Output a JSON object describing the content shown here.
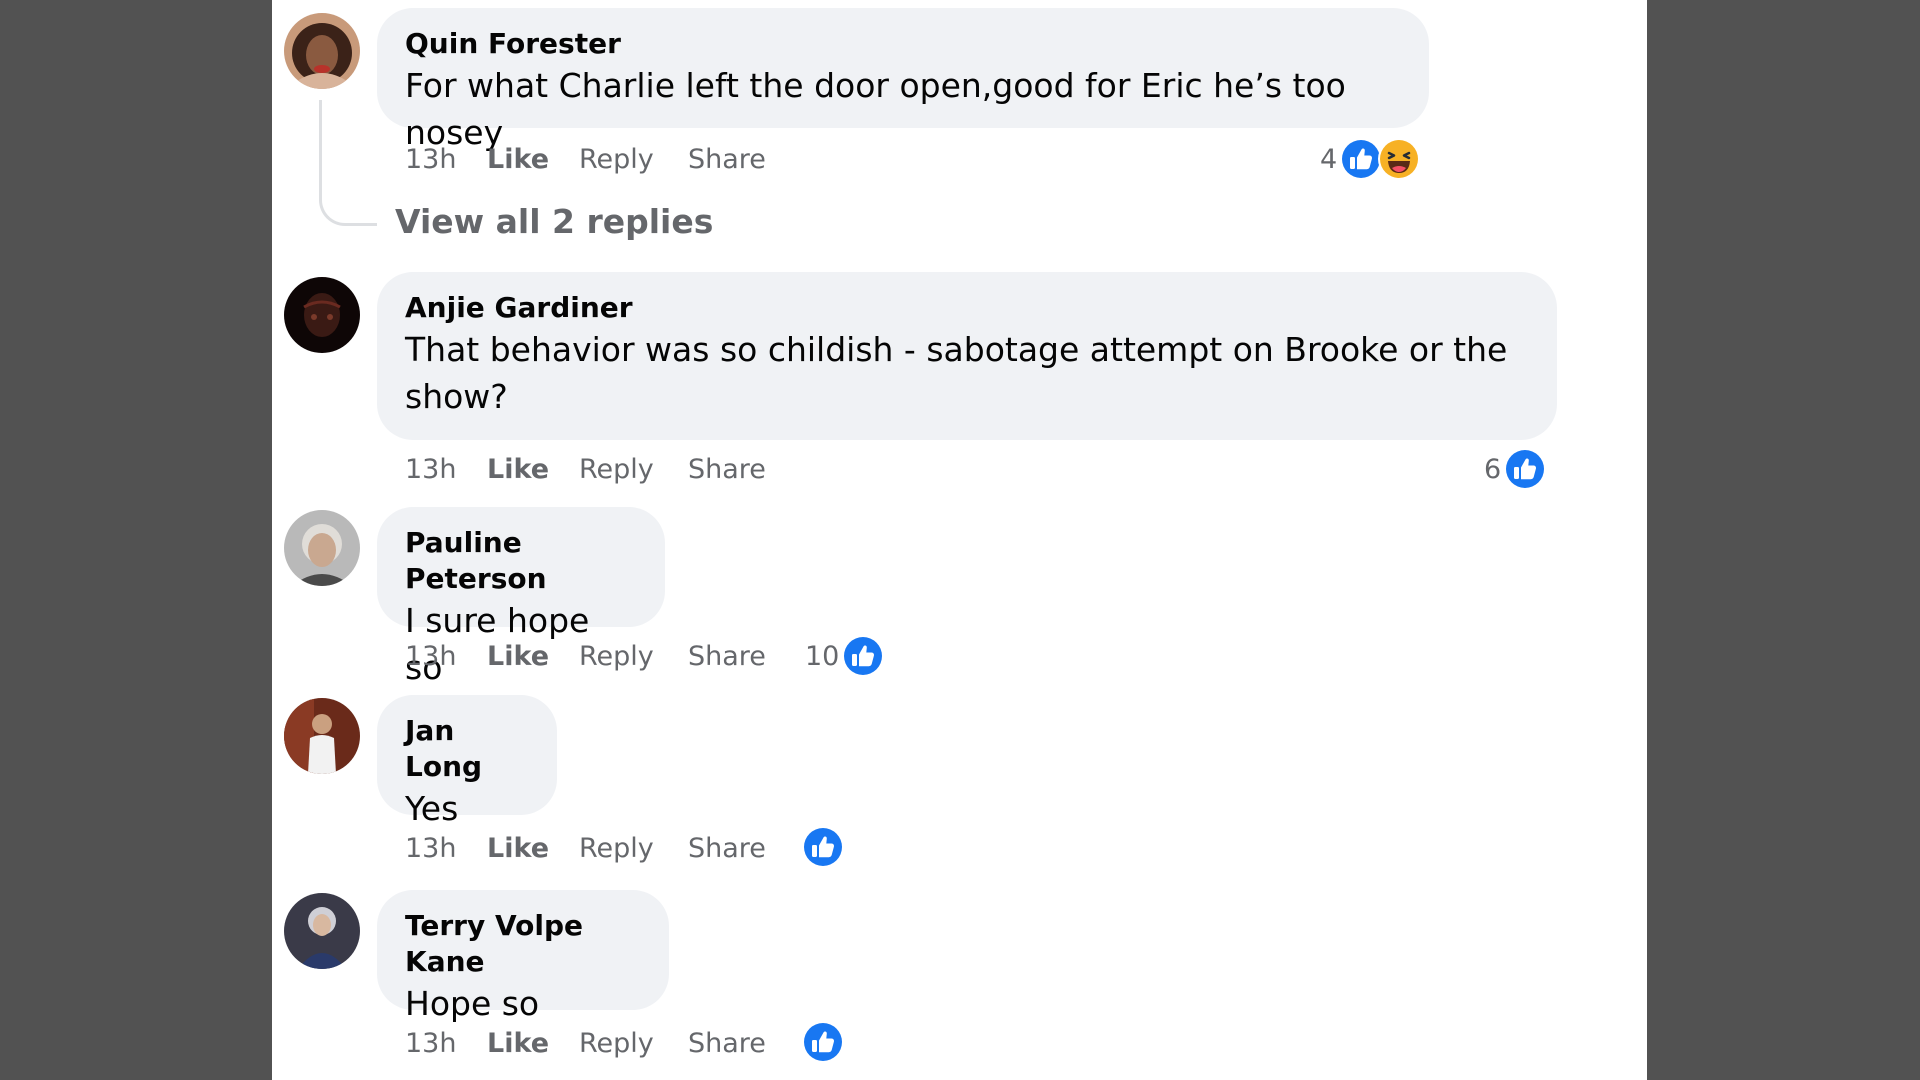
{
  "comments": [
    {
      "author": "Quin Forester",
      "text": "For what Charlie left the door open,good for Eric he’s too nosey",
      "time": "13h",
      "like": "Like",
      "reply": "Reply",
      "share": "Share",
      "reaction_count": "4",
      "reactions": [
        "like-icon",
        "haha-icon"
      ],
      "view_replies": "View all 2 replies"
    },
    {
      "author": "Anjie Gardiner",
      "text_line1": "That behavior was so childish - sabotage attempt on Brooke or the",
      "text_line2": "show?",
      "time": "13h",
      "like": "Like",
      "reply": "Reply",
      "share": "Share",
      "reaction_count": "6",
      "reactions": [
        "like-icon"
      ]
    },
    {
      "author": "Pauline Peterson",
      "text": "I sure hope so",
      "time": "13h",
      "like": "Like",
      "reply": "Reply",
      "share": "Share",
      "reaction_count": "10",
      "reactions": [
        "like-icon"
      ]
    },
    {
      "author": "Jan Long",
      "text": "Yes",
      "time": "13h",
      "like": "Like",
      "reply": "Reply",
      "share": "Share",
      "reactions": [
        "like-icon"
      ]
    },
    {
      "author": "Terry Volpe Kane",
      "text": "Hope so",
      "time": "13h",
      "like": "Like",
      "reply": "Reply",
      "share": "Share",
      "reactions": [
        "like-icon"
      ]
    }
  ],
  "colors": {
    "background": "#525252",
    "panel": "#ffffff",
    "bubble": "#f0f2f5",
    "secondary_text": "#65676b",
    "like_blue": "#1877f2",
    "haha_yellow": "#f7b125"
  }
}
